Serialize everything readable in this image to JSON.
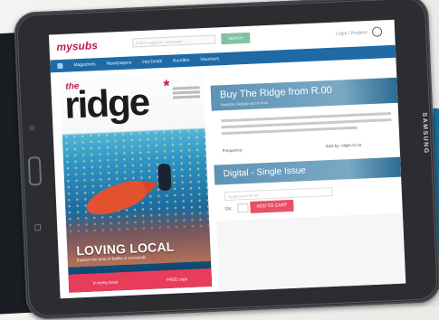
{
  "device": {
    "brand": "SAMSUNG"
  },
  "header": {
    "logo_my": "my",
    "logo_subs": "subs",
    "search_placeholder": "Find a magazine, newspaper...",
    "search_button": "SEARCH",
    "login_text": "Login / Register"
  },
  "nav": {
    "items": [
      "Magazines",
      "Newspapers",
      "Hot Deals",
      "Bundles",
      "Vouchers"
    ]
  },
  "cover": {
    "the": "the",
    "title": "ridge",
    "star": "*",
    "headline": "LOVING LOCAL",
    "subline": "Explore the best of Ballito & surrounds",
    "strip_left": "In every issue",
    "strip_right": "FREE copy"
  },
  "product": {
    "buy_title": "Buy The Ridge from R.00",
    "buy_sub": "Available Digitally and in Print",
    "frequency_label": "Frequency:",
    "sold_label": "Sold by: ridge.co.za"
  },
  "digital": {
    "title": "Digital - Single Issue",
    "select_placeholder": "Single Issue R0.00",
    "qty_label": "Qty:",
    "add_to_cart": "ADD TO CART"
  },
  "colors": {
    "brand_pink": "#c2185b",
    "nav_blue": "#1f6aa5",
    "cta_pink": "#e8506a",
    "panel_blue": "#5f93b3"
  }
}
